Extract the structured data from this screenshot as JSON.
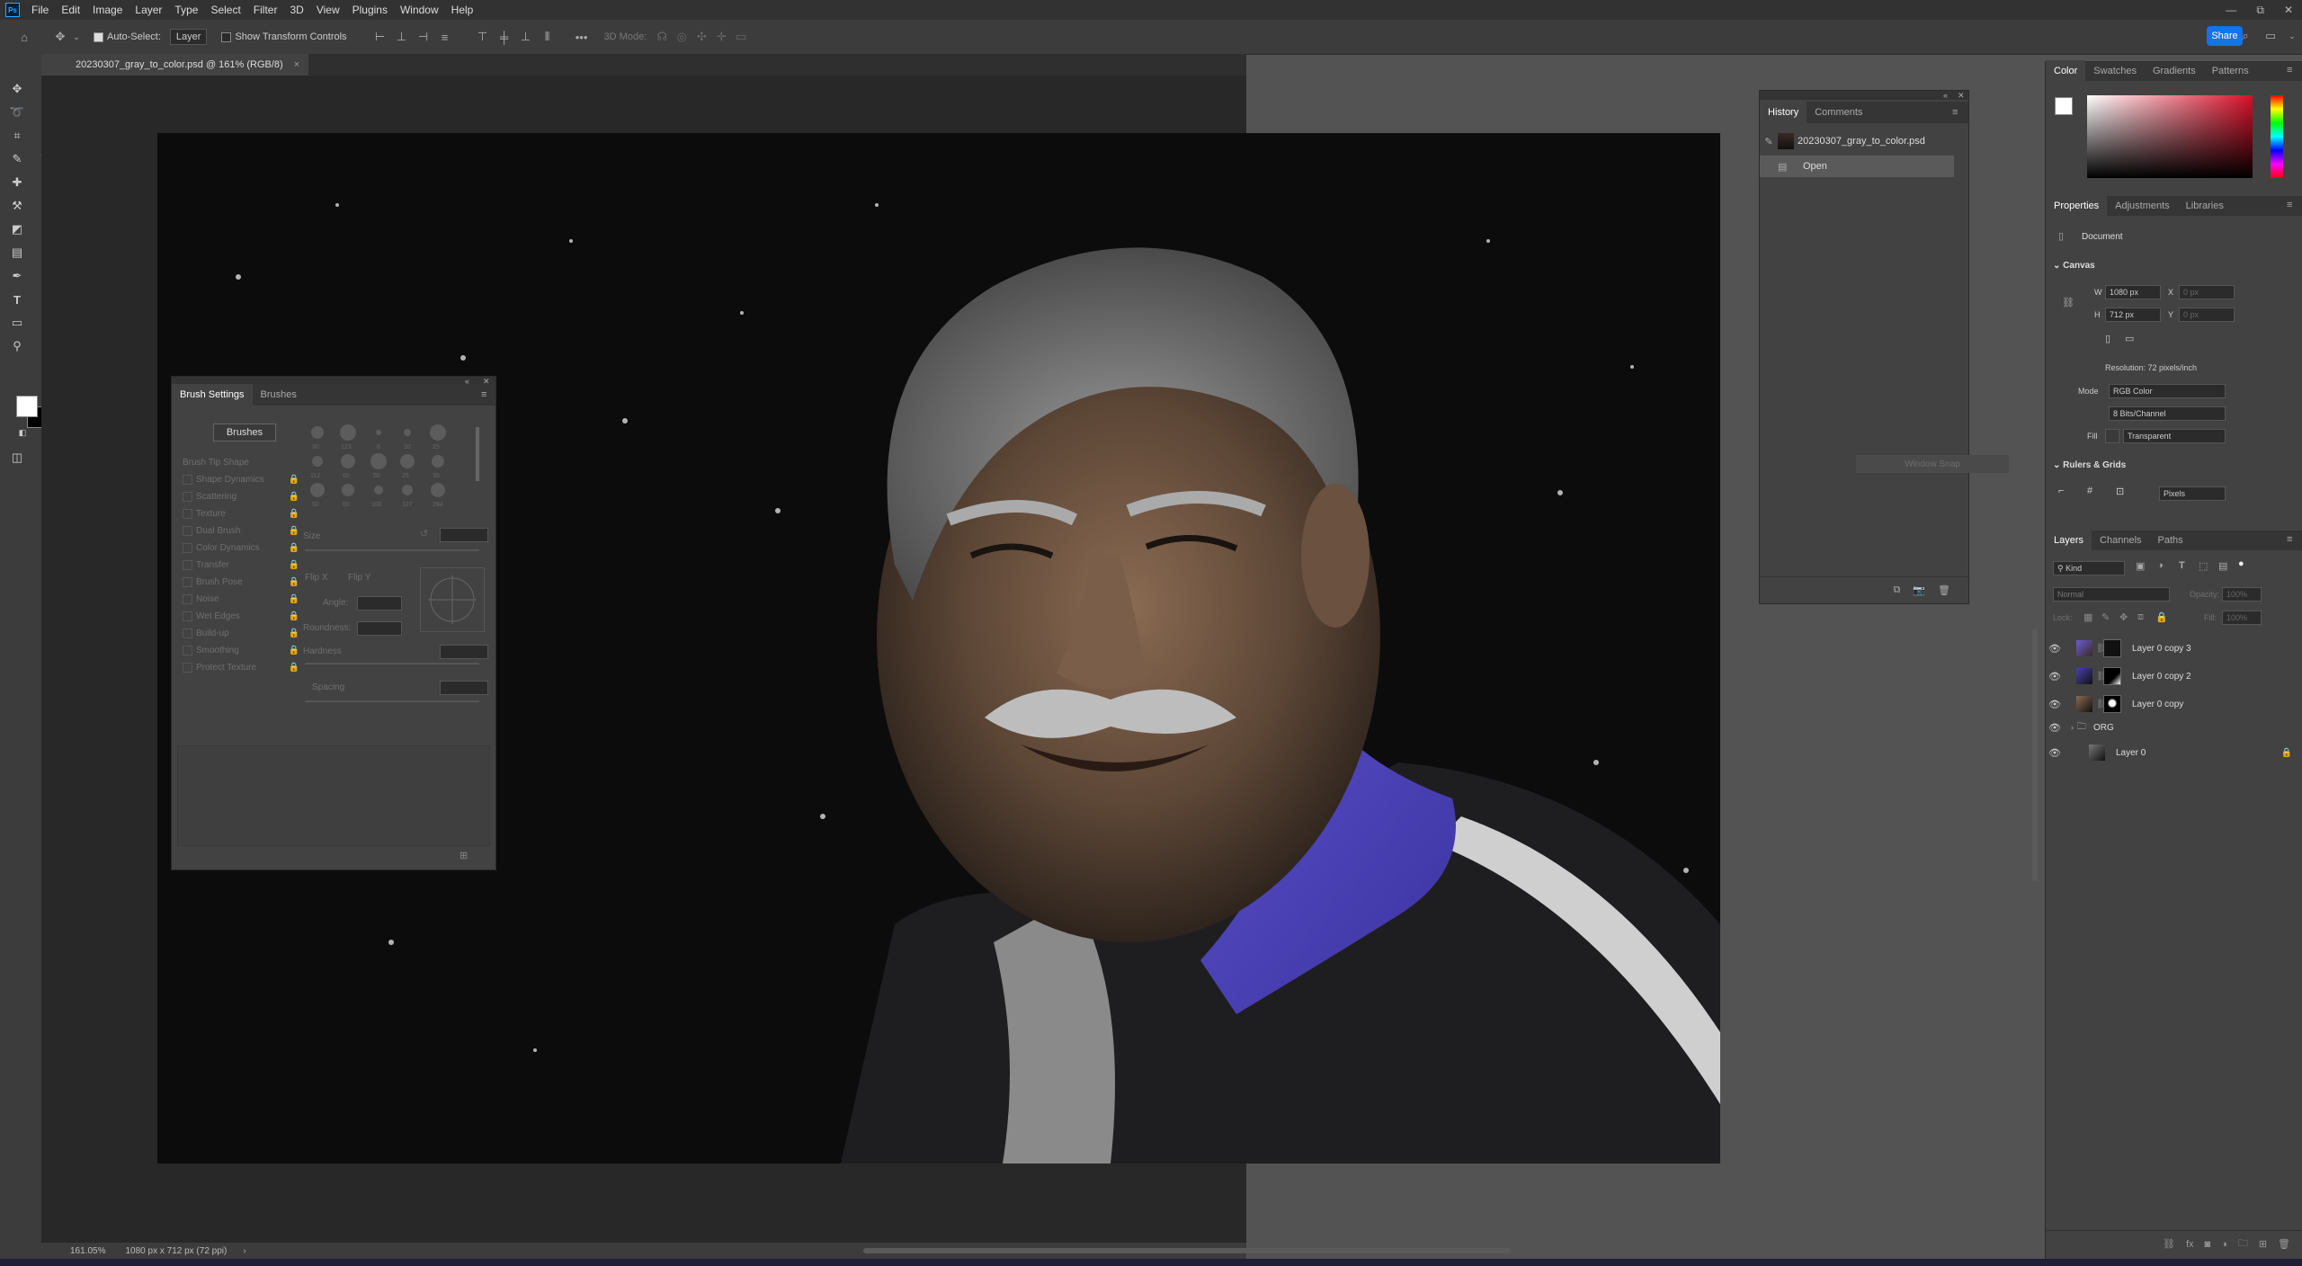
{
  "menu": {
    "logo": "Ps",
    "items": [
      "File",
      "Edit",
      "Image",
      "Layer",
      "Type",
      "Select",
      "Filter",
      "3D",
      "View",
      "Plugins",
      "Window",
      "Help"
    ]
  },
  "window_controls": [
    "—",
    "⧉",
    "✕"
  ],
  "options": {
    "auto_select_label": "Auto-Select:",
    "auto_select_value": "Layer",
    "transform_label": "Show Transform Controls",
    "mode_3d": "3D Mode:",
    "share": "Share"
  },
  "document": {
    "tab_title": "20230307_gray_to_color.psd @ 161% (RGB/8)",
    "close": "×",
    "zoom": "161.05%",
    "dimensions": "1080 px x 712 px (72 ppi)"
  },
  "brush_settings": {
    "tabs": [
      "Brush Settings",
      "Brushes"
    ],
    "brushes_button": "Brushes",
    "options": [
      "Brush Tip Shape",
      "Shape Dynamics",
      "Scattering",
      "Texture",
      "Dual Brush",
      "Color Dynamics",
      "Transfer",
      "Brush Pose",
      "Noise",
      "Wet Edges",
      "Build-up",
      "Smoothing",
      "Protect Texture"
    ],
    "size_label": "Size",
    "flip_x": "Flip X",
    "flip_y": "Flip Y",
    "angle_label": "Angle:",
    "roundness_label": "Roundness:",
    "hardness_label": "Hardness",
    "spacing_label": "Spacing",
    "preset_sizes": [
      "30",
      "123",
      "8",
      "10",
      "25",
      "112",
      "60",
      "50",
      "25",
      "30",
      "50",
      "60",
      "100",
      "127",
      "284",
      "80"
    ]
  },
  "history": {
    "tabs": [
      "History",
      "Comments"
    ],
    "snapshot": "20230307_gray_to_color.psd",
    "steps": [
      "Open"
    ]
  },
  "color_panel": {
    "tabs": [
      "Color",
      "Swatches",
      "Gradients",
      "Patterns"
    ],
    "hue_color": "#d8102a"
  },
  "properties": {
    "tabs": [
      "Properties",
      "Adjustments",
      "Libraries"
    ],
    "doc_label": "Document",
    "canvas_header": "Canvas",
    "w_label": "W",
    "w_value": "1080 px",
    "h_label": "H",
    "h_value": "712 px",
    "x_label": "X",
    "x_value": "0 px",
    "y_label": "Y",
    "y_value": "0 px",
    "resolution": "Resolution: 72 pixels/inch",
    "mode_label": "Mode",
    "mode_value": "RGB Color",
    "depth_value": "8 Bits/Channel",
    "fill_label": "Fill",
    "fill_value": "Transparent",
    "rulers_header": "Rulers & Grids",
    "units_value": "Pixels",
    "window_snap": "Window Snap"
  },
  "layers": {
    "tabs": [
      "Layers",
      "Channels",
      "Paths"
    ],
    "filter_kind": "Kind",
    "blend_mode": "Normal",
    "opacity_label": "Opacity:",
    "opacity_value": "100%",
    "lock_label": "Lock:",
    "fill_label": "Fill:",
    "fill_value": "100%",
    "items": [
      {
        "name": "Layer 0 copy 3",
        "mask": "#111"
      },
      {
        "name": "Layer 0 copy 2",
        "mask": "#000"
      },
      {
        "name": "Layer 0 copy",
        "mask": "#000"
      },
      {
        "name": "ORG",
        "mask": ""
      },
      {
        "name": "Layer 0",
        "mask": ""
      }
    ]
  },
  "colors": {
    "accent": "#1473e6",
    "jacket_purple": "#6a5cd6"
  }
}
